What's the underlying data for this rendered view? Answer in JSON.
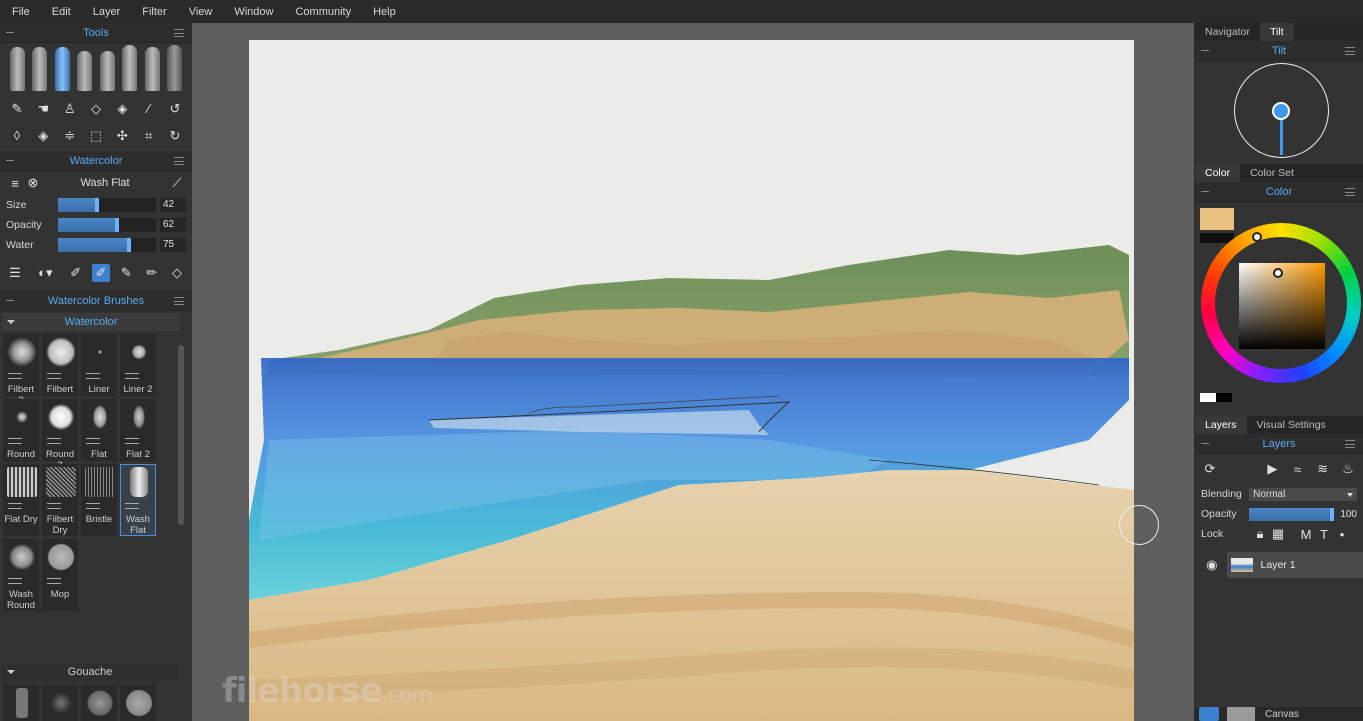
{
  "menu": [
    "File",
    "Edit",
    "Layer",
    "Filter",
    "View",
    "Window",
    "Community",
    "Help"
  ],
  "left": {
    "tools_title": "Tools",
    "watercolor_title": "Watercolor",
    "brush_name": "Wash Flat",
    "sliders": [
      {
        "label": "Size",
        "value": "42",
        "level": 0.42
      },
      {
        "label": "Opacity",
        "value": "62",
        "level": 0.62
      },
      {
        "label": "Water",
        "value": "75",
        "level": 0.75
      }
    ],
    "brushes_title": "Watercolor Brushes",
    "group_title": "Watercolor",
    "brushes": [
      "Filbert 2",
      "Filbert",
      "Liner",
      "Liner 2",
      "Round",
      "Round 2",
      "Flat",
      "Flat 2",
      "Flat Dry",
      "Filbert Dry",
      "Bristle",
      "Wash Flat",
      "Wash Round",
      "Mop"
    ],
    "selected_brush": "Wash Flat",
    "group2_title": "Gouache"
  },
  "watermark": {
    "brand": "filehorse",
    "suffix": ".com"
  },
  "right": {
    "tabs_top": [
      "Navigator",
      "Tilt"
    ],
    "tilt_title": "Tilt",
    "tabs_color": [
      "Color",
      "Color Set"
    ],
    "color_title": "Color",
    "current_color": "#e8c080",
    "tabs_layers": [
      "Layers",
      "Visual Settings"
    ],
    "layers_title": "Layers",
    "blending_label": "Blending",
    "blending_value": "Normal",
    "opacity_label": "Opacity",
    "opacity_value": "100",
    "opacity_level": 1.0,
    "lock_label": "Lock",
    "layer_name": "Layer 1",
    "bottom_label": "Canvas"
  },
  "colors": {
    "accent": "#5aaaf0",
    "panel": "#333333",
    "canvas_bg": "#5e5e5e"
  }
}
